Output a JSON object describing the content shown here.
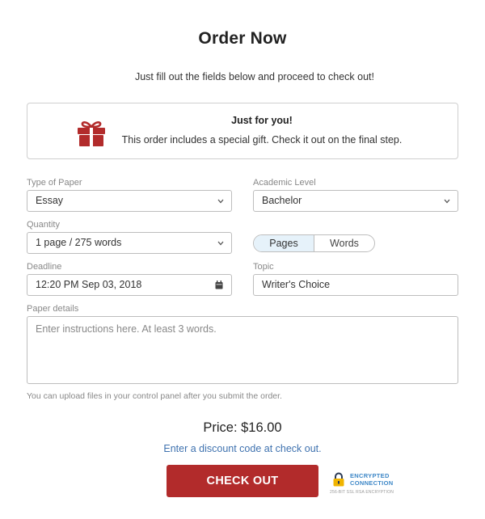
{
  "header": {
    "title": "Order Now",
    "subtitle": "Just fill out the fields below and proceed to check out!"
  },
  "gift": {
    "icon": "gift-icon",
    "heading": "Just for you!",
    "text": "This order includes a special gift. Check it out on the final step."
  },
  "form": {
    "type_of_paper": {
      "label": "Type of Paper",
      "value": "Essay"
    },
    "academic_level": {
      "label": "Academic Level",
      "value": "Bachelor"
    },
    "quantity": {
      "label": "Quantity",
      "value": "1 page / 275 words"
    },
    "unit_toggle": {
      "options": [
        "Pages",
        "Words"
      ],
      "selected": "Pages"
    },
    "deadline": {
      "label": "Deadline",
      "value": "12:20 PM Sep 03, 2018"
    },
    "topic": {
      "label": "Topic",
      "value": "Writer's Choice"
    },
    "paper_details": {
      "label": "Paper details",
      "placeholder": "Enter instructions here. At least 3 words."
    },
    "upload_note": "You can upload files in your control panel after you submit the order."
  },
  "summary": {
    "price": "Price: $16.00",
    "discount_link": "Enter a discount code at check out.",
    "checkout_label": "CHECK OUT"
  },
  "security": {
    "line1": "ENCRYPTED",
    "line2": "CONNECTION",
    "line3": "256-BIT SSL RSA ENCRYPTION"
  },
  "colors": {
    "accent": "#b22b2b",
    "link": "#3f72af",
    "toggle_active": "#e6f2fa"
  }
}
